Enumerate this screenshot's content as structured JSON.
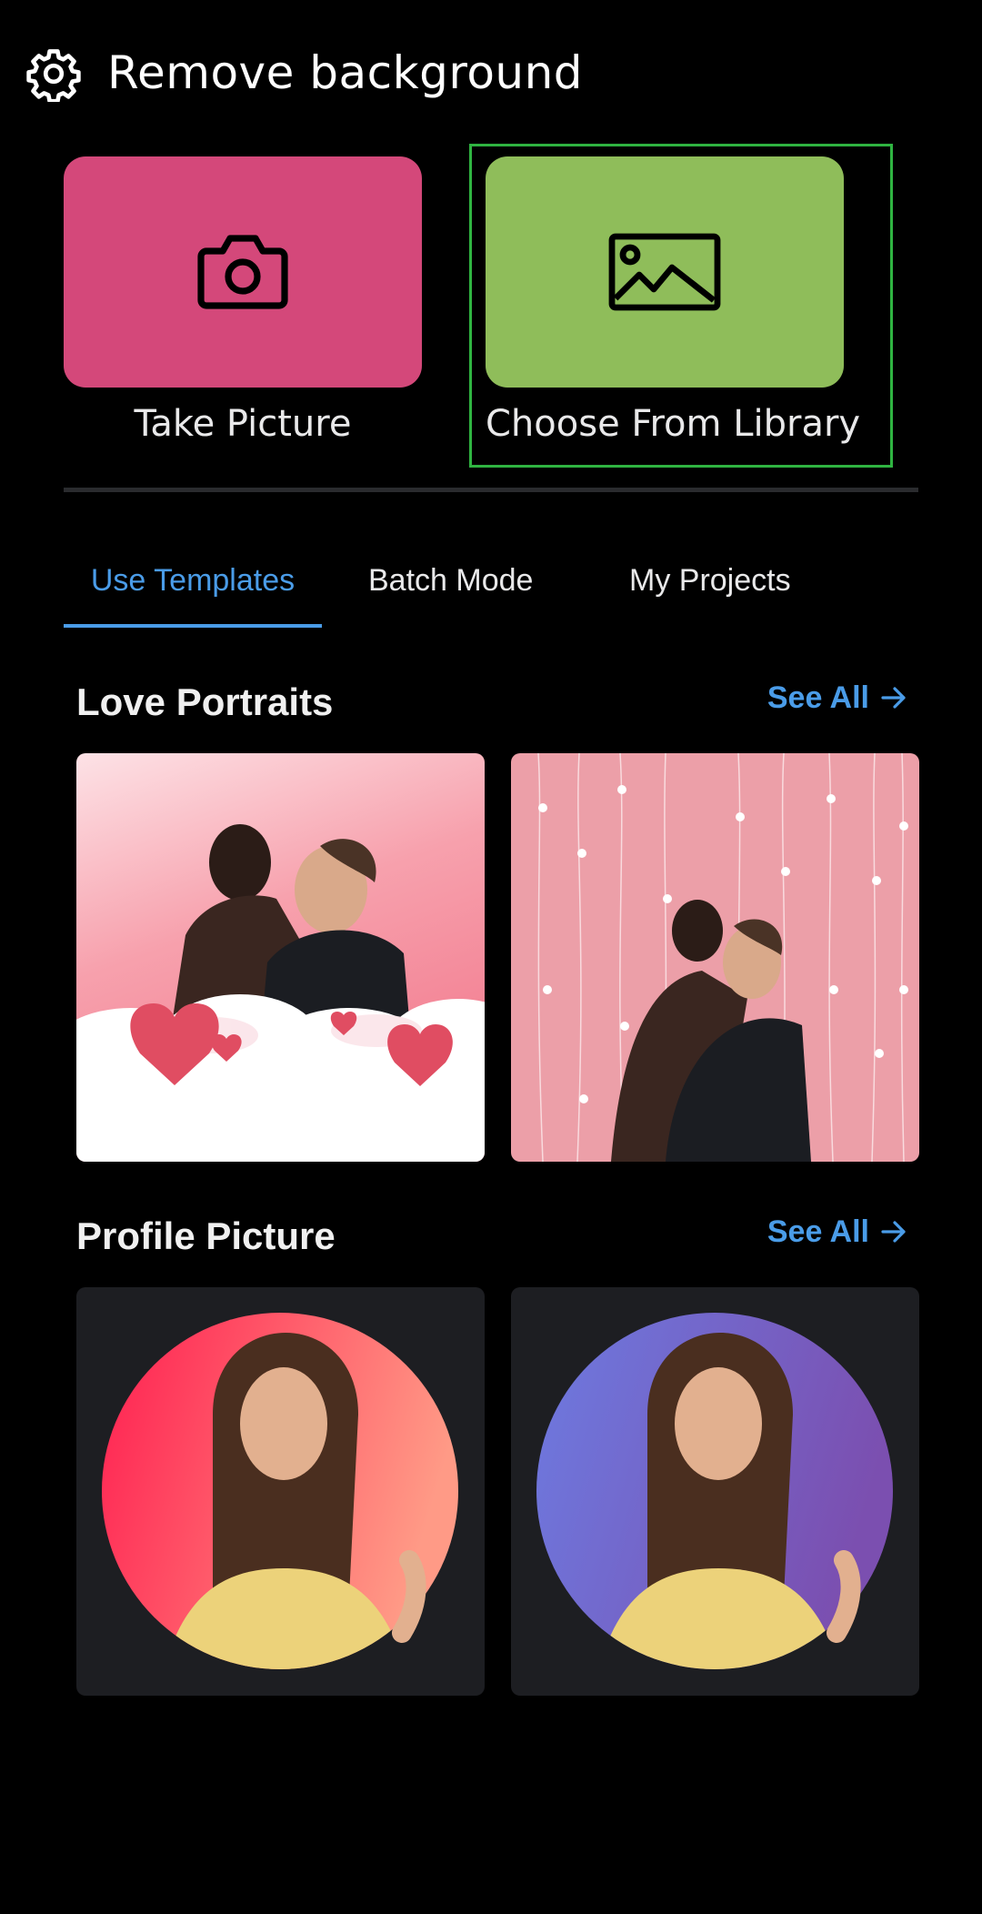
{
  "header": {
    "title": "Remove background",
    "settings_icon": "gear-icon"
  },
  "actions": {
    "camera": {
      "label": "Take Picture",
      "icon": "camera-icon",
      "color": "#d4487a"
    },
    "library": {
      "label": "Choose From Library",
      "icon": "image-icon",
      "color": "#8fbd5a"
    },
    "highlight_color": "#2fb441"
  },
  "tabs": [
    {
      "label": "Use Templates",
      "active": true
    },
    {
      "label": "Batch Mode",
      "active": false
    },
    {
      "label": "My Projects",
      "active": false
    }
  ],
  "accent": "#4a9ce8",
  "sections": [
    {
      "title": "Love Portraits",
      "see_all": "See All"
    },
    {
      "title": "Profile Picture",
      "see_all": "See All"
    }
  ]
}
